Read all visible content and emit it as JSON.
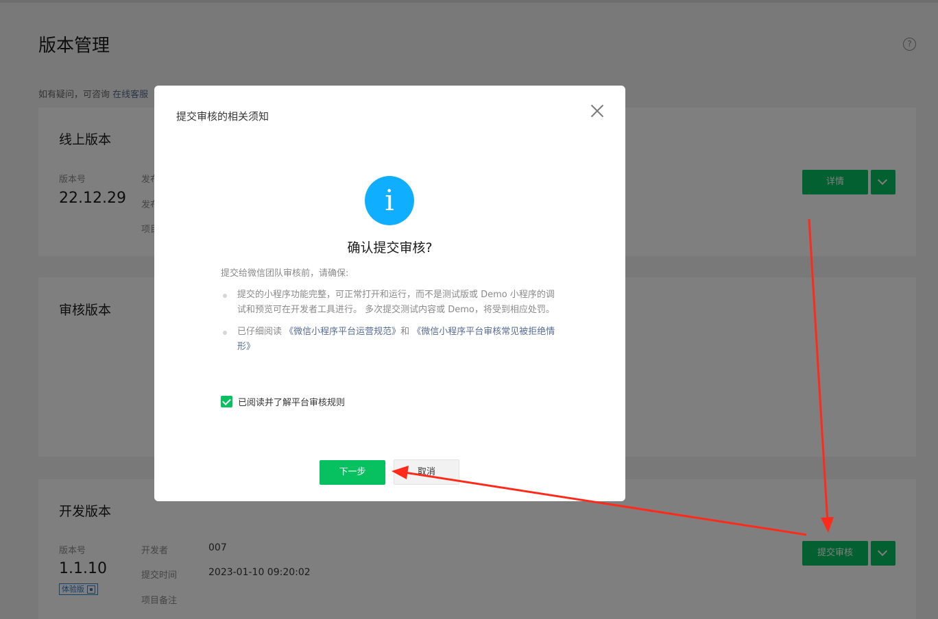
{
  "page": {
    "title": "版本管理",
    "help_icon_text": "?",
    "tip_prefix": "如有疑问，可咨询 ",
    "tip_link": "在线客服"
  },
  "online": {
    "title": "线上版本",
    "version_label": "版本号",
    "version": "22.12.29",
    "publisher_label": "发布者",
    "time_label": "发布时间",
    "note_label": "项目备注",
    "detail_button": "详情"
  },
  "review": {
    "title": "审核版本"
  },
  "dev": {
    "title": "开发版本",
    "version_label": "版本号",
    "version": "1.1.10",
    "badge": "体验版",
    "developer_label": "开发者",
    "developer": "007",
    "submit_time_label": "提交时间",
    "submit_time": "2023-01-10 09:20:02",
    "note_label": "项目备注",
    "submit_button": "提交审核"
  },
  "modal": {
    "title": "提交审核的相关须知",
    "confirm_title": "确认提交审核?",
    "desc": "提交给微信团队审核前，请确保:",
    "rule1": "提交的小程序功能完整，可正常打开和运行，而不是测试版或 Demo 小程序的调试和预览可在开发者工具进行。 多次提交测试内容或 Demo，将受到相应处罚。",
    "rule2_prefix": "已仔细阅读 ",
    "rule2_link1": "《微信小程序平台运营规范》",
    "rule2_mid": "和 ",
    "rule2_link2": "《微信小程序平台审核常见被拒绝情形》",
    "checkbox_label": "已阅读并了解平台审核规则",
    "next_button": "下一步",
    "cancel_button": "取消",
    "info_icon_text": "i"
  },
  "colors": {
    "brand_green": "#07c160",
    "info_blue": "#10aeff",
    "link": "#576b95",
    "annotation_arrow": "#ff2a1a"
  }
}
